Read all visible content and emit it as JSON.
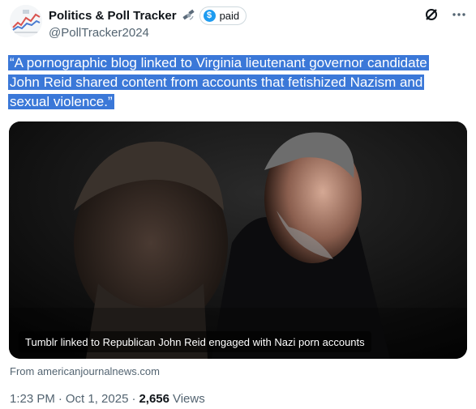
{
  "header": {
    "display_name": "Politics & Poll Tracker",
    "paid_label": "paid",
    "handle": "@PollTracker2024",
    "icons": [
      "satellite-icon",
      "dollar-icon",
      "grok-icon",
      "more-icon"
    ]
  },
  "tweet": {
    "text_lines": [
      "“A pornographic blog linked to Virginia lieutenant governor candidate",
      "John Reid shared content from accounts that fetishized Nazism and",
      "sexual violence.”"
    ],
    "highlight_color": "#3b78d8"
  },
  "card": {
    "caption": "Tumblr linked to Republican John Reid engaged with Nazi porn accounts",
    "source": "From americanjournalnews.com"
  },
  "meta": {
    "time": "1:23 PM",
    "date": "Oct 1, 2025",
    "views_count": "2,656",
    "views_label": "Views"
  },
  "colors": {
    "secondary_text": "#536471",
    "primary_text": "#0f1419",
    "accent": "#1d9bf0"
  }
}
